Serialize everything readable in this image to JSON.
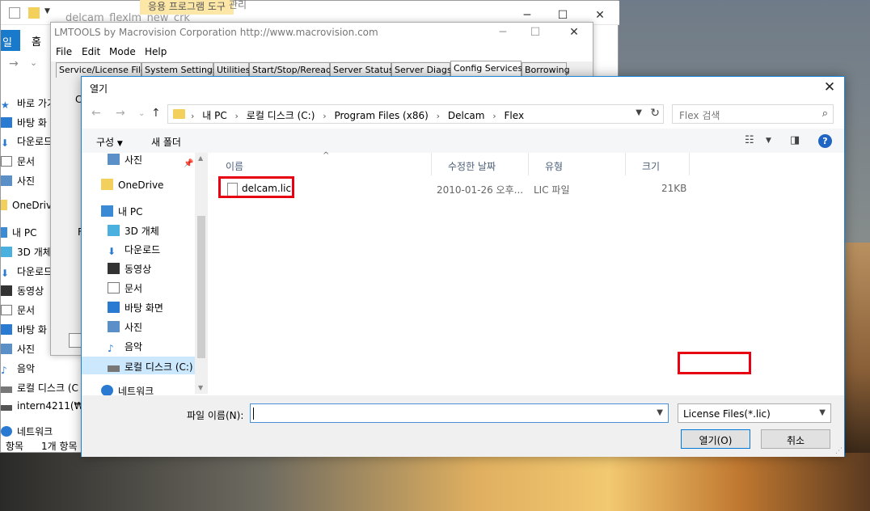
{
  "explorer": {
    "title": "delcam_flexlm_new_crk",
    "tab_active": "응용 프로그램 도구",
    "tab_manage": "관리",
    "ribbon_file": "일",
    "ribbon_home": "홈",
    "sidebar": [
      {
        "label": "바로 가기",
        "icon": "star-icon"
      },
      {
        "label": "바탕 화",
        "icon": "desktop-icon"
      },
      {
        "label": "다운로드",
        "icon": "download-icon"
      },
      {
        "label": "문서",
        "icon": "document-icon"
      },
      {
        "label": "사진",
        "icon": "picture-icon"
      },
      {
        "label": "OneDrive",
        "icon": "folder-icon"
      },
      {
        "label": "내 PC",
        "icon": "pc-icon"
      },
      {
        "label": "3D 개체",
        "icon": "cube-icon"
      },
      {
        "label": "다운로드",
        "icon": "download-icon"
      },
      {
        "label": "동영상",
        "icon": "video-icon"
      },
      {
        "label": "문서",
        "icon": "document-icon"
      },
      {
        "label": "바탕 화",
        "icon": "desktop-icon"
      },
      {
        "label": "사진",
        "icon": "picture-icon"
      },
      {
        "label": "음악",
        "icon": "music-icon"
      },
      {
        "label": "로컬 디스크 (C",
        "icon": "drive-icon"
      },
      {
        "label": "intern4211(₩₩",
        "icon": "network-drive-icon"
      },
      {
        "label": "네트워크",
        "icon": "network-icon"
      }
    ],
    "status_count": "항목",
    "status_selected": "1개 항목"
  },
  "lmtools": {
    "title": "LMTOOLS by Macrovision Corporation http://www.macrovision.com",
    "menu": [
      "File",
      "Edit",
      "Mode",
      "Help"
    ],
    "tabs": [
      "Service/License File",
      "System Settings",
      "Utilities",
      "Start/Stop/Reread",
      "Server Status",
      "Server Diags",
      "Config Services",
      "Borrowing"
    ],
    "active_tab": "Config Services",
    "partial_c": "C",
    "partial_f": "F"
  },
  "dialog": {
    "title": "열기",
    "breadcrumb": [
      "내 PC",
      "로컬 디스크 (C:)",
      "Program Files (x86)",
      "Delcam",
      "Flex"
    ],
    "search_placeholder": "Flex 검색",
    "toolbar": {
      "organize": "구성",
      "new_folder": "새 폴더"
    },
    "nav": [
      {
        "label": "사진",
        "icon": "picture-icon"
      },
      {
        "label": "OneDrive",
        "icon": "folder-icon"
      },
      {
        "label": "내 PC",
        "icon": "pc-icon"
      },
      {
        "label": "3D 개체",
        "icon": "cube-icon"
      },
      {
        "label": "다운로드",
        "icon": "download-icon"
      },
      {
        "label": "동영상",
        "icon": "video-icon"
      },
      {
        "label": "문서",
        "icon": "document-icon"
      },
      {
        "label": "바탕 화면",
        "icon": "desktop-icon"
      },
      {
        "label": "사진",
        "icon": "picture-icon"
      },
      {
        "label": "음악",
        "icon": "music-icon"
      },
      {
        "label": "로컬 디스크 (C:)",
        "icon": "drive-icon"
      },
      {
        "label": "네트워크",
        "icon": "network-icon"
      }
    ],
    "columns": [
      "이름",
      "수정한 날짜",
      "유형",
      "크기"
    ],
    "files": [
      {
        "name": "delcam.lic",
        "modified": "2010-01-26 오후...",
        "type": "LIC 파일",
        "size": "21KB"
      }
    ],
    "filename_label": "파일 이름(N):",
    "filename_value": "",
    "filetype": "License Files(*.lic)",
    "open_button": "열기(O)",
    "cancel_button": "취소"
  },
  "colors": {
    "accent": "#0078d7",
    "highlight": "#e60012",
    "selected_nav": "#cce8ff"
  }
}
